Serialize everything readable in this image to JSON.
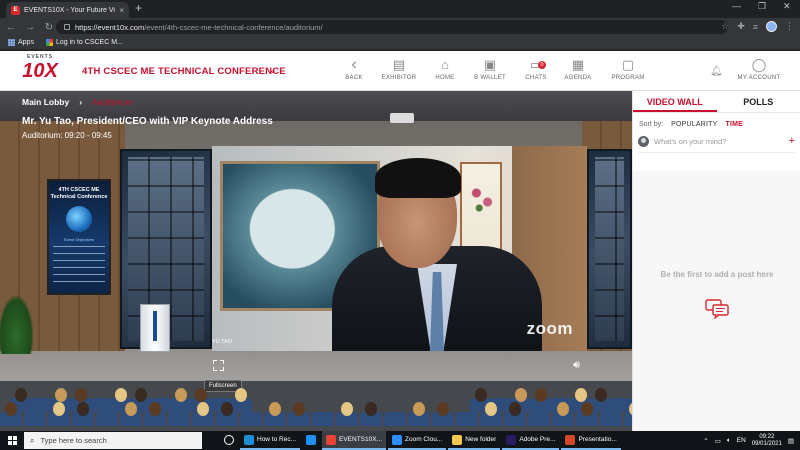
{
  "browser": {
    "tab_title": "EVENTS10X - Your Future Vi",
    "tab_close": "×",
    "new_tab": "+",
    "url_host": "https://event10x.com",
    "url_path": "/event/4th-cscec-me-technical-conference/auditorium/",
    "bookmarks": [
      {
        "label": "Apps",
        "icon": "apps-grid-icon"
      },
      {
        "label": "Log in to CSCEC M...",
        "icon": "site-favicon-icon"
      }
    ],
    "win_controls": [
      "—",
      "❐",
      "✕"
    ]
  },
  "header": {
    "logo_top": "EVENTS",
    "logo_main": "10X",
    "conference_title": "4TH CSCEC ME TECHNICAL CONFERENCE",
    "nav": [
      {
        "label": "BACK",
        "icon": "chevron-left-icon",
        "glyph": "‹"
      },
      {
        "label": "EXHIBITOR",
        "icon": "building-icon",
        "glyph": "▤"
      },
      {
        "label": "HOME",
        "icon": "home-icon",
        "glyph": "⌂"
      },
      {
        "label": "B WALLET",
        "icon": "wallet-icon",
        "glyph": "▣"
      },
      {
        "label": "CHATS",
        "icon": "chat-icon",
        "glyph": "▭",
        "badge": "0"
      },
      {
        "label": "AGENDA",
        "icon": "agenda-icon",
        "glyph": "▦"
      },
      {
        "label": "PROGRAM",
        "icon": "program-icon",
        "glyph": "▢"
      },
      {
        "label": "MY ACCOUNT",
        "icon": "account-icon",
        "glyph": "◯"
      }
    ]
  },
  "stage": {
    "breadcrumb_root": "Main Lobby",
    "breadcrumb_sep": "›",
    "breadcrumb_current": "Auditorium",
    "session_title": "Mr. Yu Tao, President/CEO with VIP Keynote Address",
    "session_time": "Auditorium: 09:20 - 09:45",
    "speaker_name_tag": "YU TAO",
    "video_watermark": "zoom",
    "fullscreen_tooltip": "Fullscreen",
    "poster_title": "4TH CSCEC ME Technical Conference",
    "poster_subtitle": "Event Objectives"
  },
  "sidebar": {
    "tabs": [
      {
        "label": "VIDEO WALL",
        "active": true
      },
      {
        "label": "POLLS",
        "active": false
      }
    ],
    "sort_label": "Sort by:",
    "sort_options": [
      {
        "label": "POPULARITY",
        "active": false
      },
      {
        "label": "TIME",
        "active": true
      }
    ],
    "composer_placeholder": "What's on your mind?",
    "composer_add": "+",
    "empty_message": "Be the first to add a post here"
  },
  "taskbar": {
    "search_placeholder": "Type here to search",
    "apps": [
      {
        "label": "",
        "icon": "task-view-icon",
        "color": "#ffffff"
      },
      {
        "label": "How to Rec...",
        "icon": "edge-icon",
        "color": "#1b8fd6"
      },
      {
        "label": "",
        "icon": "ie-icon",
        "color": "#1e90ff"
      },
      {
        "label": "EVENTS10X...",
        "icon": "chrome-icon",
        "color": "#ea4335",
        "active": true
      },
      {
        "label": "Zoom Clou...",
        "icon": "zoom-app-icon",
        "color": "#2d8cff"
      },
      {
        "label": "New folder",
        "icon": "folder-icon",
        "color": "#f2c94c"
      },
      {
        "label": "Adobe Pre...",
        "icon": "premiere-icon",
        "color": "#2a1a5e"
      },
      {
        "label": "Presentatio...",
        "icon": "powerpoint-icon",
        "color": "#d24726"
      }
    ],
    "tray_lang": "EN",
    "clock_time": "09:22",
    "clock_date": "09/01/2021"
  },
  "colors": {
    "brand_red": "#c8102e",
    "chrome_dark": "#202124",
    "chrome_bar": "#35363a",
    "taskbar": "#101418"
  }
}
